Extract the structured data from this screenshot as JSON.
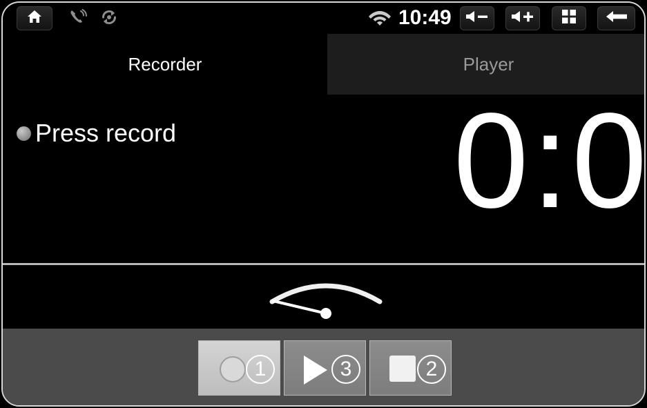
{
  "statusbar": {
    "home_icon": "home-icon",
    "phone_icon": "phone-call-icon",
    "sync_icon": "sync-refresh-icon",
    "wifi_icon": "wifi-icon",
    "clock": "10:49",
    "volume_down_label": "volume-down-icon",
    "volume_up_label": "volume-up-icon",
    "grid_label": "apps-grid-icon",
    "back_label": "back-arrow-icon",
    "background": "#000000",
    "text_color": "#ffffff"
  },
  "tabs": [
    {
      "label": "Recorder",
      "active": true
    },
    {
      "label": "Player",
      "active": false
    }
  ],
  "display": {
    "status_text": "Press record",
    "status_indicator": "idle-dot",
    "timer": "0:0",
    "background": "#000000",
    "text_color": "#ffffff"
  },
  "meter": {
    "name": "vu-meter",
    "needle_position": "minimum",
    "arc_color": "#ffffff"
  },
  "toolbar": {
    "background": "#4b4b4b",
    "buttons": [
      {
        "name": "record-button",
        "glyph": "record-circle-icon",
        "badge": "1",
        "state": "highlighted"
      },
      {
        "name": "play-button",
        "glyph": "play-triangle-icon",
        "badge": "3",
        "state": "normal"
      },
      {
        "name": "stop-button",
        "glyph": "stop-square-icon",
        "badge": "2",
        "state": "normal"
      }
    ]
  }
}
